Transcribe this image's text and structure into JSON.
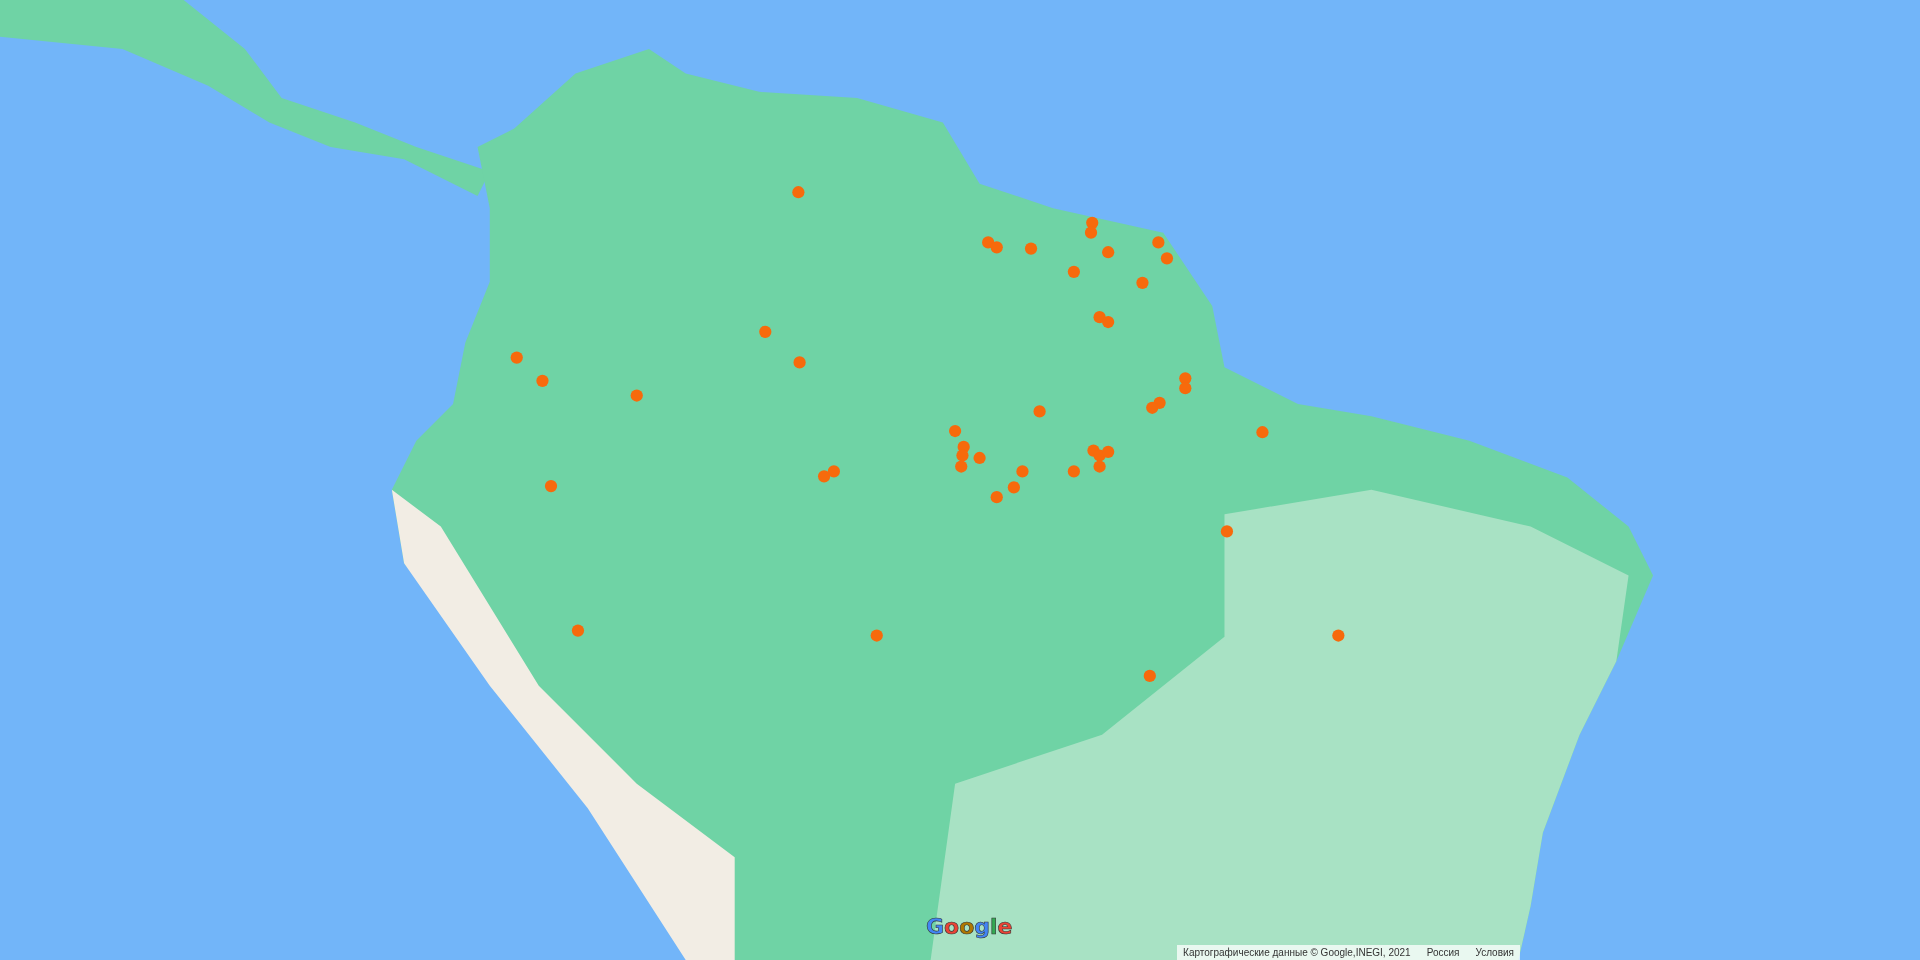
{
  "map": {
    "logo": "Google",
    "attribution": {
      "data_credit": "Картографические данные © Google,INEGI, 2021",
      "region": "Россия",
      "terms": "Условия"
    }
  }
}
